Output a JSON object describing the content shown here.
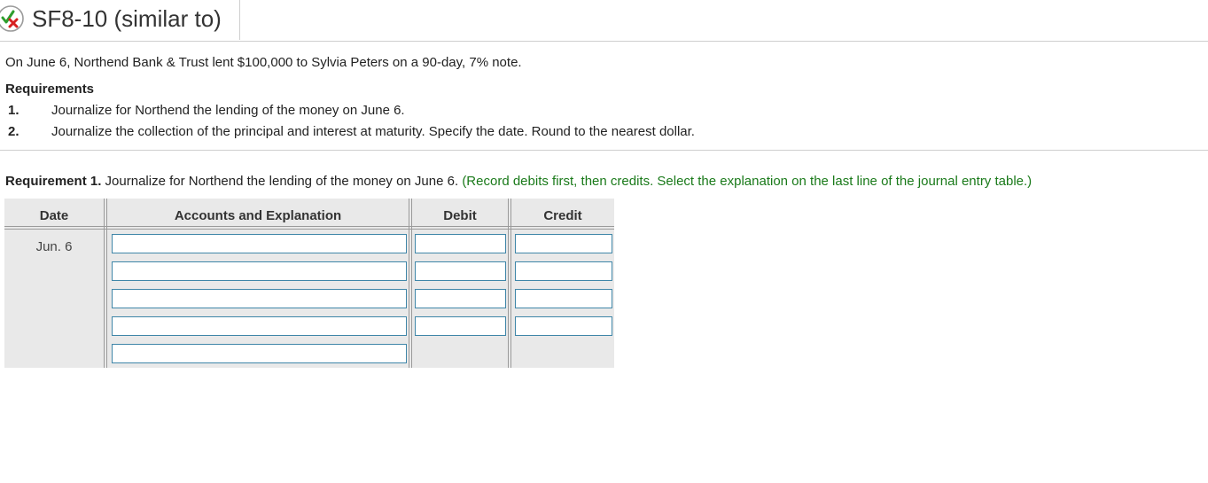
{
  "header": {
    "title": "SF8-10 (similar to)",
    "status_icon": "partially-correct-icon",
    "icon_colors": {
      "check": "#2e9e2e",
      "cross": "#d62020"
    }
  },
  "problem": {
    "statement": "On June 6, Northend Bank & Trust lent $100,000 to Sylvia Peters on a 90-day, 7% note."
  },
  "requirements": {
    "heading": "Requirements",
    "items": [
      {
        "num": "1.",
        "text": "Journalize for Northend the lending of the money on June 6."
      },
      {
        "num": "2.",
        "text": "Journalize the collection of the principal and interest at maturity. Specify the date. Round to the nearest dollar."
      }
    ]
  },
  "requirement1": {
    "label": "Requirement 1.",
    "text": " Journalize for Northend the lending of the money on June 6. ",
    "instruction": "(Record debits first, then credits. Select the explanation on the last line of the journal entry table.)"
  },
  "journal": {
    "columns": [
      "Date",
      "Accounts and Explanation",
      "Debit",
      "Credit"
    ],
    "date": "Jun. 6",
    "rows": [
      {
        "account": "",
        "debit": "",
        "credit": ""
      },
      {
        "account": "",
        "debit": "",
        "credit": ""
      },
      {
        "account": "",
        "debit": "",
        "credit": ""
      },
      {
        "account": "",
        "debit": "",
        "credit": ""
      }
    ],
    "explanation": ""
  }
}
